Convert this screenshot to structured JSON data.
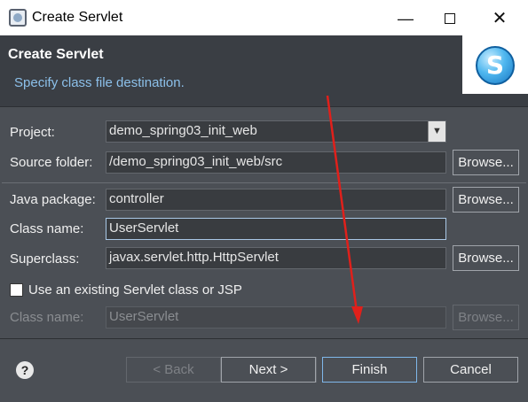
{
  "window": {
    "title": "Create Servlet",
    "minimize_icon": "minimize-icon",
    "maximize_icon": "maximize-icon",
    "close_icon": "close-icon"
  },
  "banner": {
    "title": "Create Servlet",
    "description": "Specify class file destination.",
    "logo_letter": "S"
  },
  "form": {
    "project": {
      "label": "Project:",
      "value": "demo_spring03_init_web"
    },
    "source_folder": {
      "label": "Source folder:",
      "value": "/demo_spring03_init_web/src",
      "button": "Browse..."
    },
    "java_package": {
      "label": "Java package:",
      "value": "controller",
      "button": "Browse..."
    },
    "class_name": {
      "label": "Class name:",
      "value": "UserServlet"
    },
    "superclass": {
      "label": "Superclass:",
      "value": "javax.servlet.http.HttpServlet",
      "button": "Browse..."
    },
    "use_existing": {
      "label": "Use an existing Servlet class or JSP",
      "checked": false
    },
    "existing_class_name": {
      "label": "Class name:",
      "value": "UserServlet",
      "button": "Browse..."
    }
  },
  "footer": {
    "help_symbol": "?",
    "back": "< Back",
    "next": "Next >",
    "finish": "Finish",
    "cancel": "Cancel"
  },
  "colors": {
    "dialog_bg": "#4b4f55",
    "banner_bg": "#3a3e44",
    "accent_text": "#8cc0ea",
    "annotation_arrow": "#e0201b"
  }
}
